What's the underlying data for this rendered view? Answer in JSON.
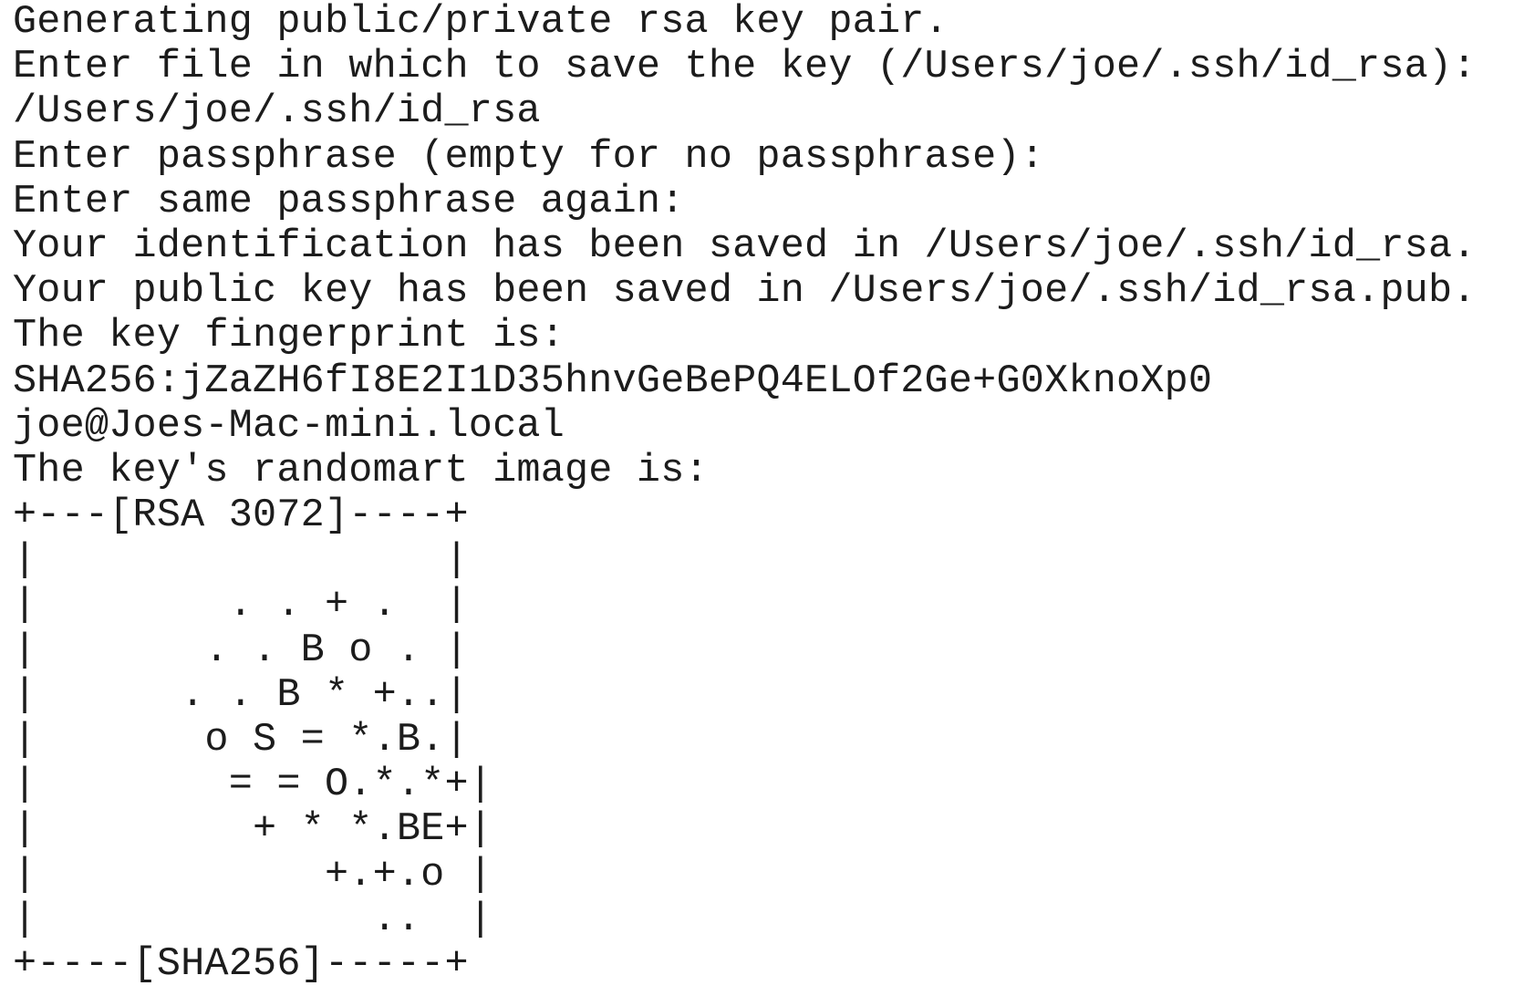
{
  "terminal": {
    "lines": [
      "Generating public/private rsa key pair.",
      "Enter file in which to save the key (/Users/joe/.ssh/id_rsa):",
      "/Users/joe/.ssh/id_rsa",
      "Enter passphrase (empty for no passphrase):",
      "Enter same passphrase again:",
      "Your identification has been saved in /Users/joe/.ssh/id_rsa.",
      "Your public key has been saved in /Users/joe/.ssh/id_rsa.pub.",
      "The key fingerprint is:",
      "SHA256:jZaZH6fI8E2I1D35hnvGeBePQ4ELOf2Ge+G0XknoXp0",
      "joe@Joes-Mac-mini.local",
      "The key's randomart image is:",
      "+---[RSA 3072]----+",
      "|                 |",
      "|        . . + .  |",
      "|       . . B o . |",
      "|      . . B * +..|",
      "|       o S = *.B.|",
      "|        = = O.*.*+|",
      "|         + * *.BE+|",
      "|            +.+.o |",
      "|              ..  |",
      "+----[SHA256]-----+"
    ]
  }
}
